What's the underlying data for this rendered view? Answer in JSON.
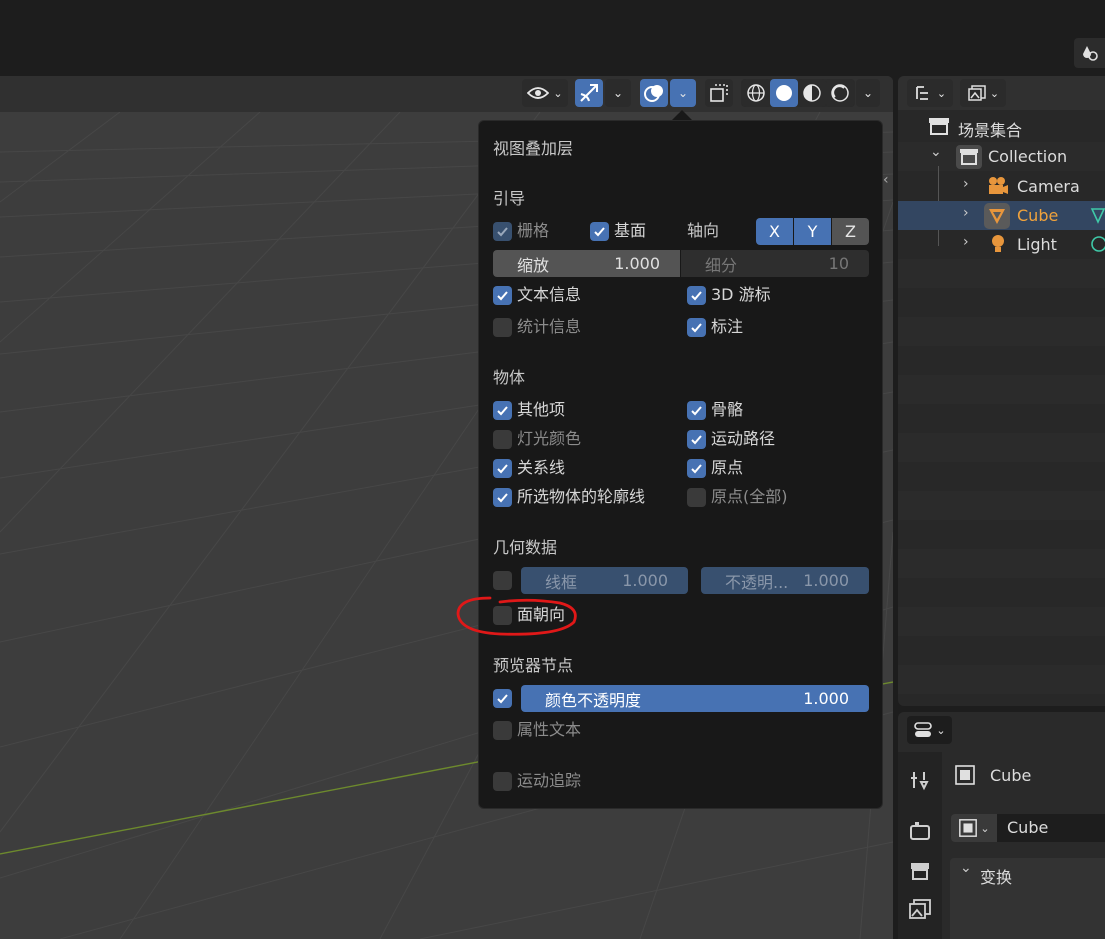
{
  "topbar": {
    "right_icon": "shading-drops-icon"
  },
  "viewport_header": {
    "visibility_icon": "eye-icon",
    "gizmo_icon": "gizmo-icon",
    "overlay_icon": "overlay-icon",
    "xray_icon": "xray-icon",
    "shading_modes": [
      "wireframe",
      "solid",
      "material-preview",
      "rendered"
    ],
    "active_shading": "solid"
  },
  "overlay_popover": {
    "title": "视图叠加层",
    "guides": {
      "header": "引导",
      "grid": "栅格",
      "floor": "基面",
      "axes_label": "轴向",
      "axes": [
        "X",
        "Y",
        "Z"
      ],
      "scale_label": "缩放",
      "scale_value": "1.000",
      "subdivisions_label": "细分",
      "subdivisions_value": "10",
      "text_info": "文本信息",
      "cursor_3d": "3D 游标",
      "statistics": "统计信息",
      "annotations": "标注"
    },
    "objects": {
      "header": "物体",
      "extras": "其他项",
      "bones": "骨骼",
      "light_colors": "灯光颜色",
      "motion_paths": "运动路径",
      "relationship_lines": "关系线",
      "origins": "原点",
      "outline_selected": "所选物体的轮廓线",
      "origins_all": "原点(全部)"
    },
    "geometry": {
      "header": "几何数据",
      "wireframe_label": "线框",
      "wireframe_value": "1.000",
      "opacity_label": "不透明...",
      "opacity_value": "1.000",
      "face_orientation": "面朝向"
    },
    "viewer_node": {
      "header": "预览器节点",
      "color_opacity_label": "颜色不透明度",
      "color_opacity_value": "1.000",
      "attribute_text": "属性文本"
    },
    "motion_tracking": "运动追踪"
  },
  "outliner": {
    "scene_collection": "场景集合",
    "items": [
      {
        "label": "Collection",
        "icon": "collection-icon"
      },
      {
        "label": "Camera",
        "icon": "camera-icon"
      },
      {
        "label": "Cube",
        "icon": "mesh-icon"
      },
      {
        "label": "Light",
        "icon": "light-icon"
      }
    ]
  },
  "properties": {
    "object_name": "Cube",
    "object_selector_value": "Cube",
    "transform_panel": "变换"
  },
  "colors": {
    "accent": "#4772b3",
    "selected_text": "#f0a23c",
    "annotation_red": "#e01818"
  }
}
